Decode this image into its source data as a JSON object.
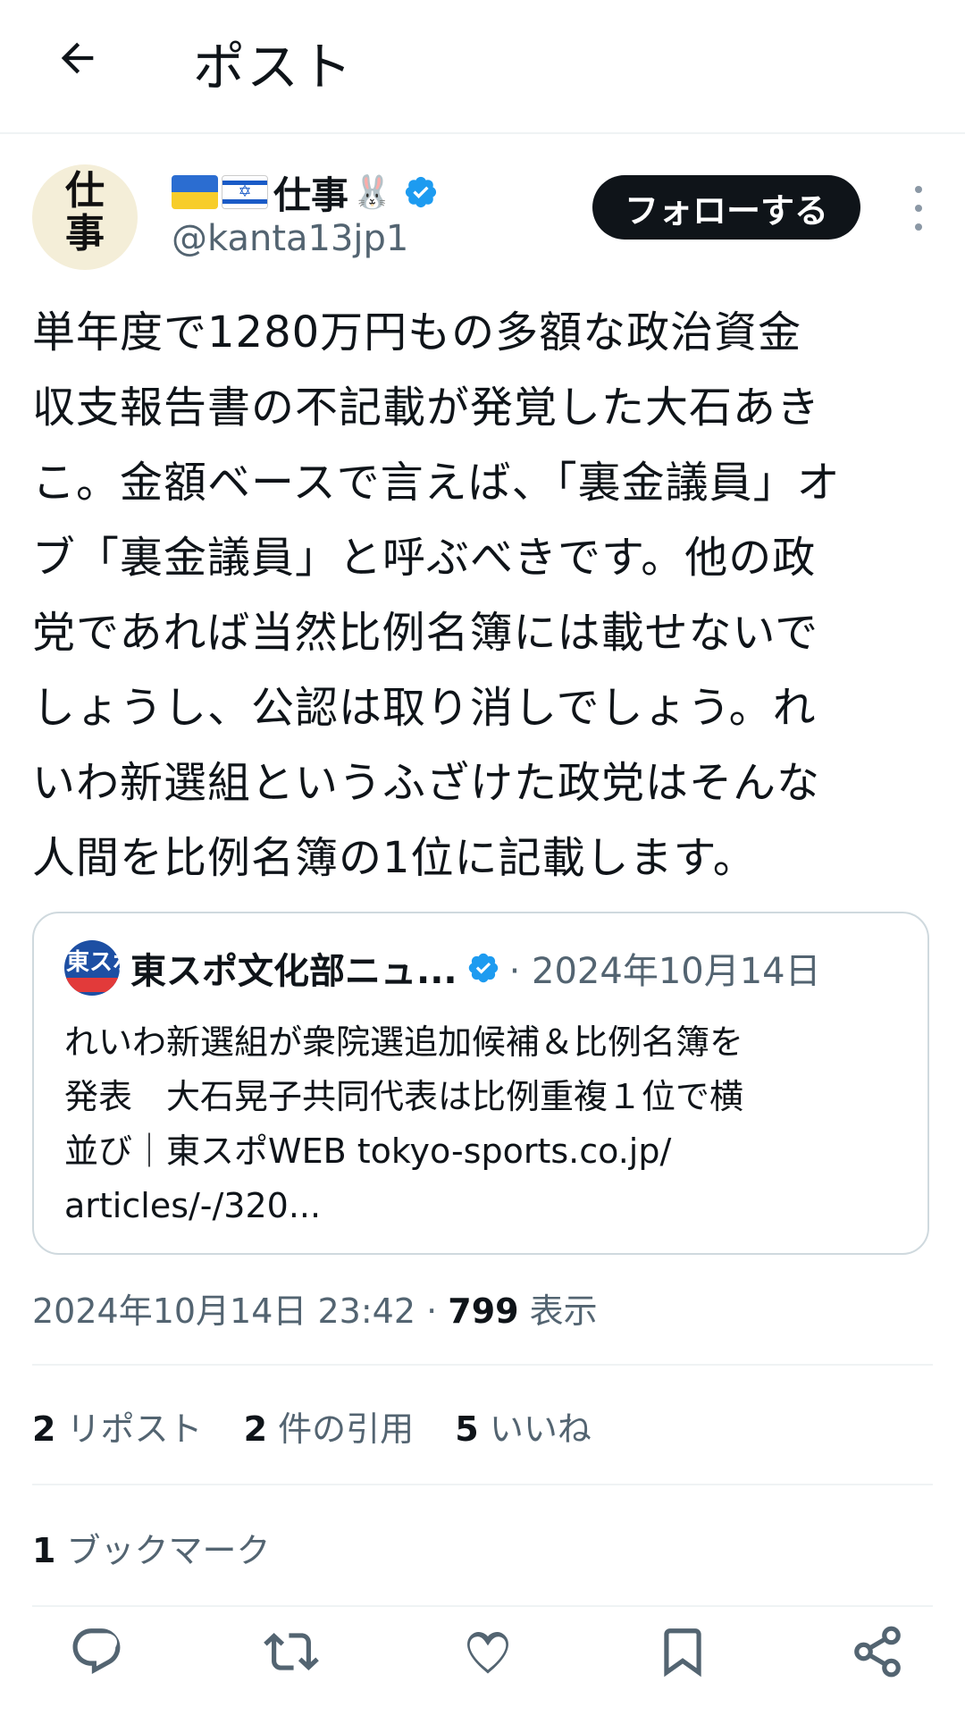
{
  "header": {
    "title": "ポスト"
  },
  "post": {
    "avatar_text": "仕\n事",
    "display_name": "仕事",
    "handle": "@kanta13jp1",
    "follow_label": "フォローする",
    "text": "単年度で1280万円もの多額な政治資金\n収支報告書の不記載が発覚した大石あき\nこ。金額ベースで言えば、「裏金議員」オ\nブ「裏金議員」と呼ぶべきです。他の政\n党であれば当然比例名簿には載せないで\nしょうし、公認は取り消しでしょう。れ\nいわ新選組というふざけた政党はそんな\n人間を比例名簿の1位に記載します。",
    "quote": {
      "avatar_text": "東スポ",
      "name": "東スポ文化部ニュ...",
      "date": "· 2024年10月14日",
      "body": "れいわ新選組が衆院選追加候補＆比例名簿を\n発表　大石晃子共同代表は比例重複１位で横\n並び｜東スポWEB tokyo-sports.co.jp/\narticles/-/320..."
    },
    "timestamp": "2024年10月14日 23:42 · ",
    "views_count": "799",
    "views_label": " 表示",
    "reposts_count": "2",
    "reposts_label": " リポスト",
    "quotes_count": "2",
    "quotes_label": " 件の引用",
    "likes_count": "5",
    "likes_label": " いいね",
    "bookmarks_count": "1",
    "bookmarks_label": " ブックマーク"
  },
  "icons": [
    "back-arrow-icon",
    "verified-icon",
    "more-icon",
    "reply-icon",
    "repost-icon",
    "like-icon",
    "bookmark-icon",
    "share-icon"
  ],
  "colors": {
    "text": "#0f1419",
    "secondary": "#536471",
    "verified": "#1d9bf0",
    "divider": "#eff3f4"
  }
}
